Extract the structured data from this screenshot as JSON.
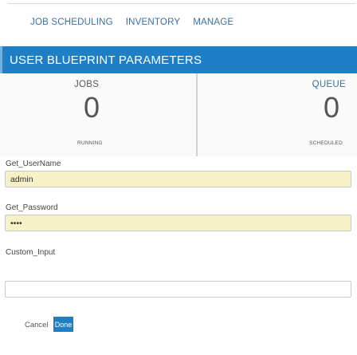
{
  "nav": {
    "items": [
      {
        "label": "JOB SCHEDULING"
      },
      {
        "label": "INVENTORY"
      },
      {
        "label": "MANAGE"
      }
    ]
  },
  "header": {
    "title": "USER BLUEPRINT PARAMETERS"
  },
  "stats": {
    "jobs": {
      "label": "JOBS",
      "value": "0",
      "sub": "RUNNING"
    },
    "queue": {
      "label": "QUEUE",
      "value": "0",
      "sub": "SCHEDULED"
    }
  },
  "form": {
    "username": {
      "label": "Get_UserName",
      "value": "admin"
    },
    "password": {
      "label": "Get_Password",
      "value": "••••"
    },
    "custom": {
      "label": "Custom_Input",
      "value": ""
    }
  },
  "actions": {
    "cancel_label": "Cancel",
    "done_label": "Done"
  },
  "colors": {
    "accent": "#1e7fc7",
    "nav_text": "#3a6f9e",
    "filled_input_bg": "#f6f1c7"
  }
}
